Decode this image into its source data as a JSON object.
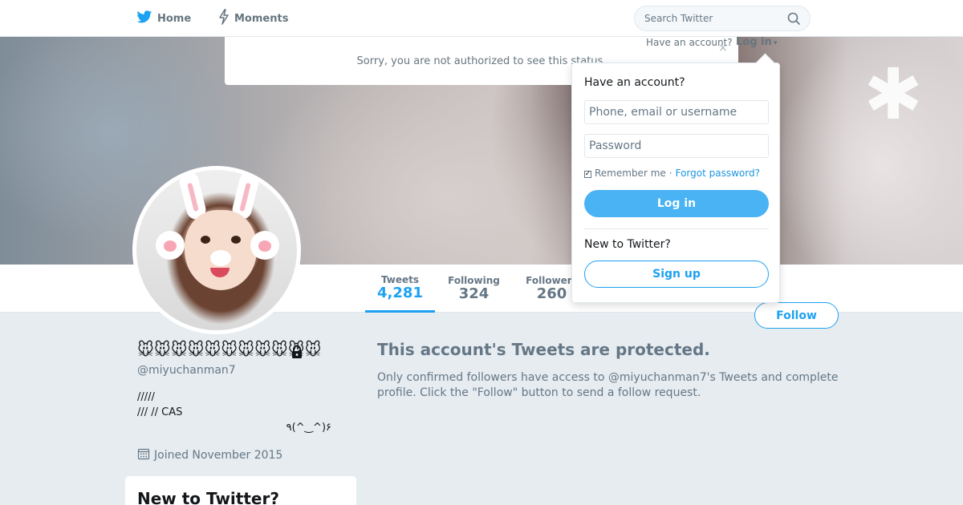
{
  "topbar": {
    "nav": [
      {
        "label": "Home",
        "icon": "twitter-bird-icon"
      },
      {
        "label": "Moments",
        "icon": "lightning-icon"
      }
    ],
    "search_placeholder": "Search Twitter",
    "have_account_text": "Have an account?",
    "login_label": "Log in",
    "caret": "▾"
  },
  "status_alert": {
    "text": "Sorry, you are not authorized to see this status.",
    "close": "×"
  },
  "login_dropdown": {
    "title": "Have an account?",
    "username_placeholder": "Phone, email or username",
    "password_placeholder": "Password",
    "remember_me": "Remember me",
    "separator": "·",
    "forgot_password": "Forgot password?",
    "login_button": "Log in",
    "new_to_twitter": "New to Twitter?",
    "signup_button": "Sign up"
  },
  "profile_nav": {
    "stats": [
      {
        "label": "Tweets",
        "value": "4,281",
        "active": true
      },
      {
        "label": "Following",
        "value": "324"
      },
      {
        "label": "Followers",
        "value": "260"
      }
    ],
    "follow_button": "Follow"
  },
  "profile": {
    "name": "🐭🐭🐭🐭🐭🐭🐭🐭🐭🐭🐭",
    "handle": "@miyuchanman7",
    "bio_lines": [
      "/////",
      "/// // CAS"
    ],
    "bio_face": "٩(^‿^)۶",
    "joined": "Joined November 2015"
  },
  "signup_module": {
    "title": "New to Twitter?"
  },
  "protected": {
    "title": "This account's Tweets are protected.",
    "body": "Only confirmed followers have access to @miyuchanman7's Tweets and complete profile. Click the \"Follow\" button to send a follow request."
  },
  "colors": {
    "brand_blue": "#1da1f2",
    "login_button_blue": "#4ab3f4",
    "page_background": "#e6ecf0",
    "muted_text": "#657786"
  }
}
